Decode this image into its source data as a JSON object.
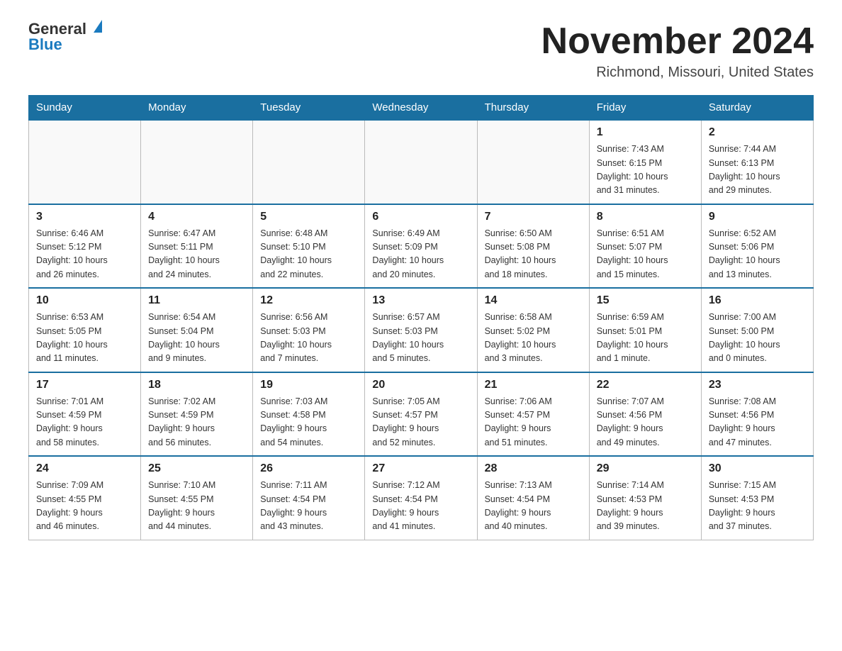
{
  "header": {
    "logo": {
      "general": "General",
      "blue": "Blue"
    },
    "title": "November 2024",
    "location": "Richmond, Missouri, United States"
  },
  "weekdays": [
    "Sunday",
    "Monday",
    "Tuesday",
    "Wednesday",
    "Thursday",
    "Friday",
    "Saturday"
  ],
  "weeks": [
    [
      {
        "day": "",
        "info": ""
      },
      {
        "day": "",
        "info": ""
      },
      {
        "day": "",
        "info": ""
      },
      {
        "day": "",
        "info": ""
      },
      {
        "day": "",
        "info": ""
      },
      {
        "day": "1",
        "info": "Sunrise: 7:43 AM\nSunset: 6:15 PM\nDaylight: 10 hours\nand 31 minutes."
      },
      {
        "day": "2",
        "info": "Sunrise: 7:44 AM\nSunset: 6:13 PM\nDaylight: 10 hours\nand 29 minutes."
      }
    ],
    [
      {
        "day": "3",
        "info": "Sunrise: 6:46 AM\nSunset: 5:12 PM\nDaylight: 10 hours\nand 26 minutes."
      },
      {
        "day": "4",
        "info": "Sunrise: 6:47 AM\nSunset: 5:11 PM\nDaylight: 10 hours\nand 24 minutes."
      },
      {
        "day": "5",
        "info": "Sunrise: 6:48 AM\nSunset: 5:10 PM\nDaylight: 10 hours\nand 22 minutes."
      },
      {
        "day": "6",
        "info": "Sunrise: 6:49 AM\nSunset: 5:09 PM\nDaylight: 10 hours\nand 20 minutes."
      },
      {
        "day": "7",
        "info": "Sunrise: 6:50 AM\nSunset: 5:08 PM\nDaylight: 10 hours\nand 18 minutes."
      },
      {
        "day": "8",
        "info": "Sunrise: 6:51 AM\nSunset: 5:07 PM\nDaylight: 10 hours\nand 15 minutes."
      },
      {
        "day": "9",
        "info": "Sunrise: 6:52 AM\nSunset: 5:06 PM\nDaylight: 10 hours\nand 13 minutes."
      }
    ],
    [
      {
        "day": "10",
        "info": "Sunrise: 6:53 AM\nSunset: 5:05 PM\nDaylight: 10 hours\nand 11 minutes."
      },
      {
        "day": "11",
        "info": "Sunrise: 6:54 AM\nSunset: 5:04 PM\nDaylight: 10 hours\nand 9 minutes."
      },
      {
        "day": "12",
        "info": "Sunrise: 6:56 AM\nSunset: 5:03 PM\nDaylight: 10 hours\nand 7 minutes."
      },
      {
        "day": "13",
        "info": "Sunrise: 6:57 AM\nSunset: 5:03 PM\nDaylight: 10 hours\nand 5 minutes."
      },
      {
        "day": "14",
        "info": "Sunrise: 6:58 AM\nSunset: 5:02 PM\nDaylight: 10 hours\nand 3 minutes."
      },
      {
        "day": "15",
        "info": "Sunrise: 6:59 AM\nSunset: 5:01 PM\nDaylight: 10 hours\nand 1 minute."
      },
      {
        "day": "16",
        "info": "Sunrise: 7:00 AM\nSunset: 5:00 PM\nDaylight: 10 hours\nand 0 minutes."
      }
    ],
    [
      {
        "day": "17",
        "info": "Sunrise: 7:01 AM\nSunset: 4:59 PM\nDaylight: 9 hours\nand 58 minutes."
      },
      {
        "day": "18",
        "info": "Sunrise: 7:02 AM\nSunset: 4:59 PM\nDaylight: 9 hours\nand 56 minutes."
      },
      {
        "day": "19",
        "info": "Sunrise: 7:03 AM\nSunset: 4:58 PM\nDaylight: 9 hours\nand 54 minutes."
      },
      {
        "day": "20",
        "info": "Sunrise: 7:05 AM\nSunset: 4:57 PM\nDaylight: 9 hours\nand 52 minutes."
      },
      {
        "day": "21",
        "info": "Sunrise: 7:06 AM\nSunset: 4:57 PM\nDaylight: 9 hours\nand 51 minutes."
      },
      {
        "day": "22",
        "info": "Sunrise: 7:07 AM\nSunset: 4:56 PM\nDaylight: 9 hours\nand 49 minutes."
      },
      {
        "day": "23",
        "info": "Sunrise: 7:08 AM\nSunset: 4:56 PM\nDaylight: 9 hours\nand 47 minutes."
      }
    ],
    [
      {
        "day": "24",
        "info": "Sunrise: 7:09 AM\nSunset: 4:55 PM\nDaylight: 9 hours\nand 46 minutes."
      },
      {
        "day": "25",
        "info": "Sunrise: 7:10 AM\nSunset: 4:55 PM\nDaylight: 9 hours\nand 44 minutes."
      },
      {
        "day": "26",
        "info": "Sunrise: 7:11 AM\nSunset: 4:54 PM\nDaylight: 9 hours\nand 43 minutes."
      },
      {
        "day": "27",
        "info": "Sunrise: 7:12 AM\nSunset: 4:54 PM\nDaylight: 9 hours\nand 41 minutes."
      },
      {
        "day": "28",
        "info": "Sunrise: 7:13 AM\nSunset: 4:54 PM\nDaylight: 9 hours\nand 40 minutes."
      },
      {
        "day": "29",
        "info": "Sunrise: 7:14 AM\nSunset: 4:53 PM\nDaylight: 9 hours\nand 39 minutes."
      },
      {
        "day": "30",
        "info": "Sunrise: 7:15 AM\nSunset: 4:53 PM\nDaylight: 9 hours\nand 37 minutes."
      }
    ]
  ]
}
